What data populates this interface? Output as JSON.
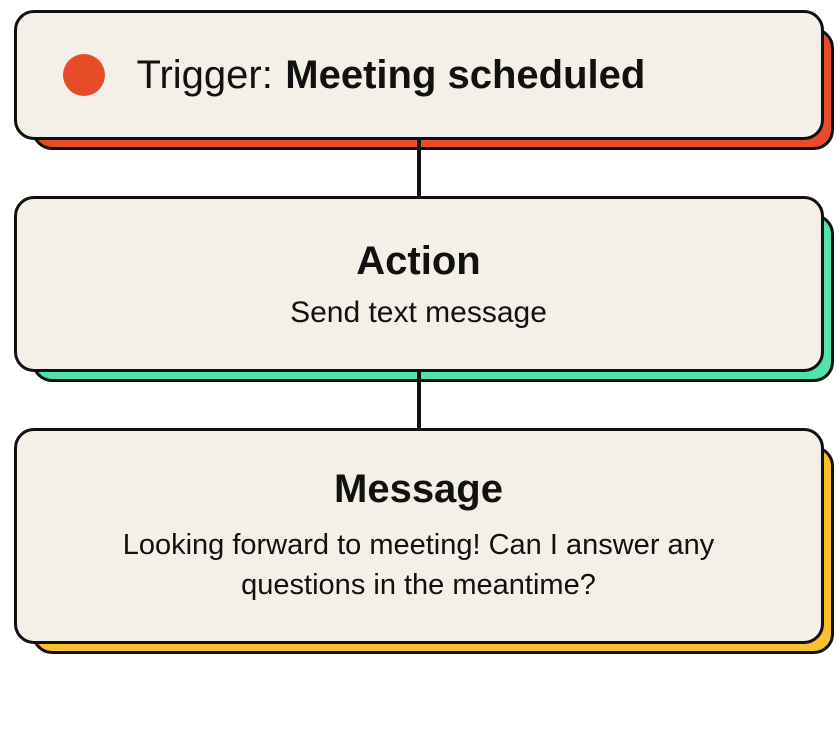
{
  "colors": {
    "trigger_accent": "#e74c28",
    "action_accent": "#53e2a9",
    "message_accent": "#fbc12d",
    "card_bg": "#f4efe7",
    "border": "#111111"
  },
  "trigger": {
    "label": "Trigger:",
    "value": "Meeting scheduled"
  },
  "action": {
    "title": "Action",
    "subtitle": "Send text message"
  },
  "message": {
    "title": "Message",
    "body": "Looking forward to meeting! Can I answer any questions in the meantime?"
  }
}
